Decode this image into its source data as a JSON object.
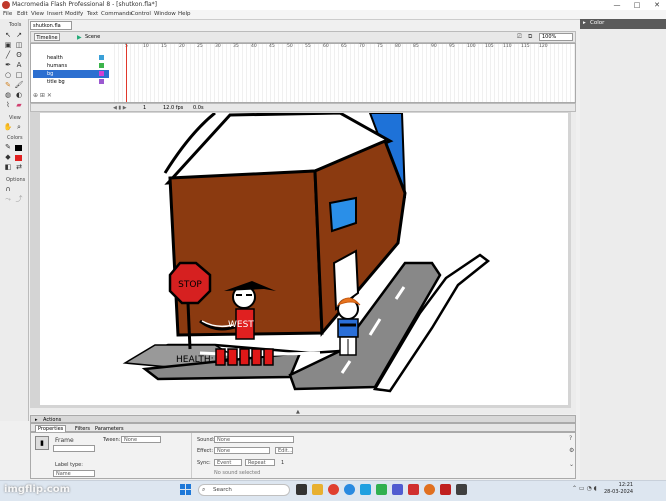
{
  "window": {
    "title": "Macromedia Flash Professional 8 - [shutkon.fla*]",
    "controls": [
      "—",
      "□",
      "✕"
    ]
  },
  "menubar": [
    "File",
    "Edit",
    "View",
    "Insert",
    "Modify",
    "Text",
    "Commands",
    "Control",
    "Window",
    "Help"
  ],
  "tools": {
    "header": "Tools",
    "view_label": "View",
    "colors_label": "Colors",
    "options_label": "Options"
  },
  "document": {
    "tab": "shutkon.fla",
    "timeline_label": "Timeline",
    "scene_label": "Scene",
    "zoom": "100%"
  },
  "timeline": {
    "layers": [
      {
        "name": "health",
        "color": "#3aa0d8"
      },
      {
        "name": "humans",
        "color": "#3cb44b"
      },
      {
        "name": "bg",
        "color": "#d33fd3"
      },
      {
        "name": "title bg",
        "color": "#9b59d0"
      }
    ],
    "selected_layer": "bg",
    "frame_numbers": [
      "5",
      "10",
      "15",
      "20",
      "25",
      "30",
      "35",
      "40",
      "45",
      "50",
      "55",
      "60",
      "65",
      "70",
      "75",
      "80",
      "85",
      "90",
      "95",
      "100",
      "105",
      "110",
      "115",
      "120"
    ],
    "current_frame": "1",
    "fps": "12.0 fps",
    "time": "0.0s"
  },
  "stage": {
    "sign_text": "STOP",
    "west_label": "WEST",
    "health_label": "HEALTH:",
    "health_blocks": 5,
    "colors": {
      "building": "#8b3a10",
      "roof": "#ffffff",
      "sky_corner": "#1e72d8",
      "window": "#2a8fe8",
      "road": "#8a8a8a",
      "sign": "#d62020",
      "health": "#e01818"
    }
  },
  "panels": {
    "actions": "Actions",
    "tabs": [
      "Properties",
      "Filters",
      "Parameters"
    ],
    "frame_label": "Frame",
    "tween_label": "Tween:",
    "tween_value": "None",
    "sound_label": "Sound:",
    "sound_value": "None",
    "effect_label": "Effect:",
    "effect_value": "None",
    "edit_button": "Edit...",
    "sync_label": "Sync:",
    "sync_value": "Event",
    "repeat_value": "Repeat",
    "repeat_count": "1",
    "no_sound": "No sound selected",
    "label_type": "Label type:",
    "label_type_value": "Name",
    "color_panel": "Color"
  },
  "taskbar": {
    "search_placeholder": "Search",
    "time": "12:21",
    "date": "28-03-2024"
  },
  "watermark": "imgflip.com"
}
